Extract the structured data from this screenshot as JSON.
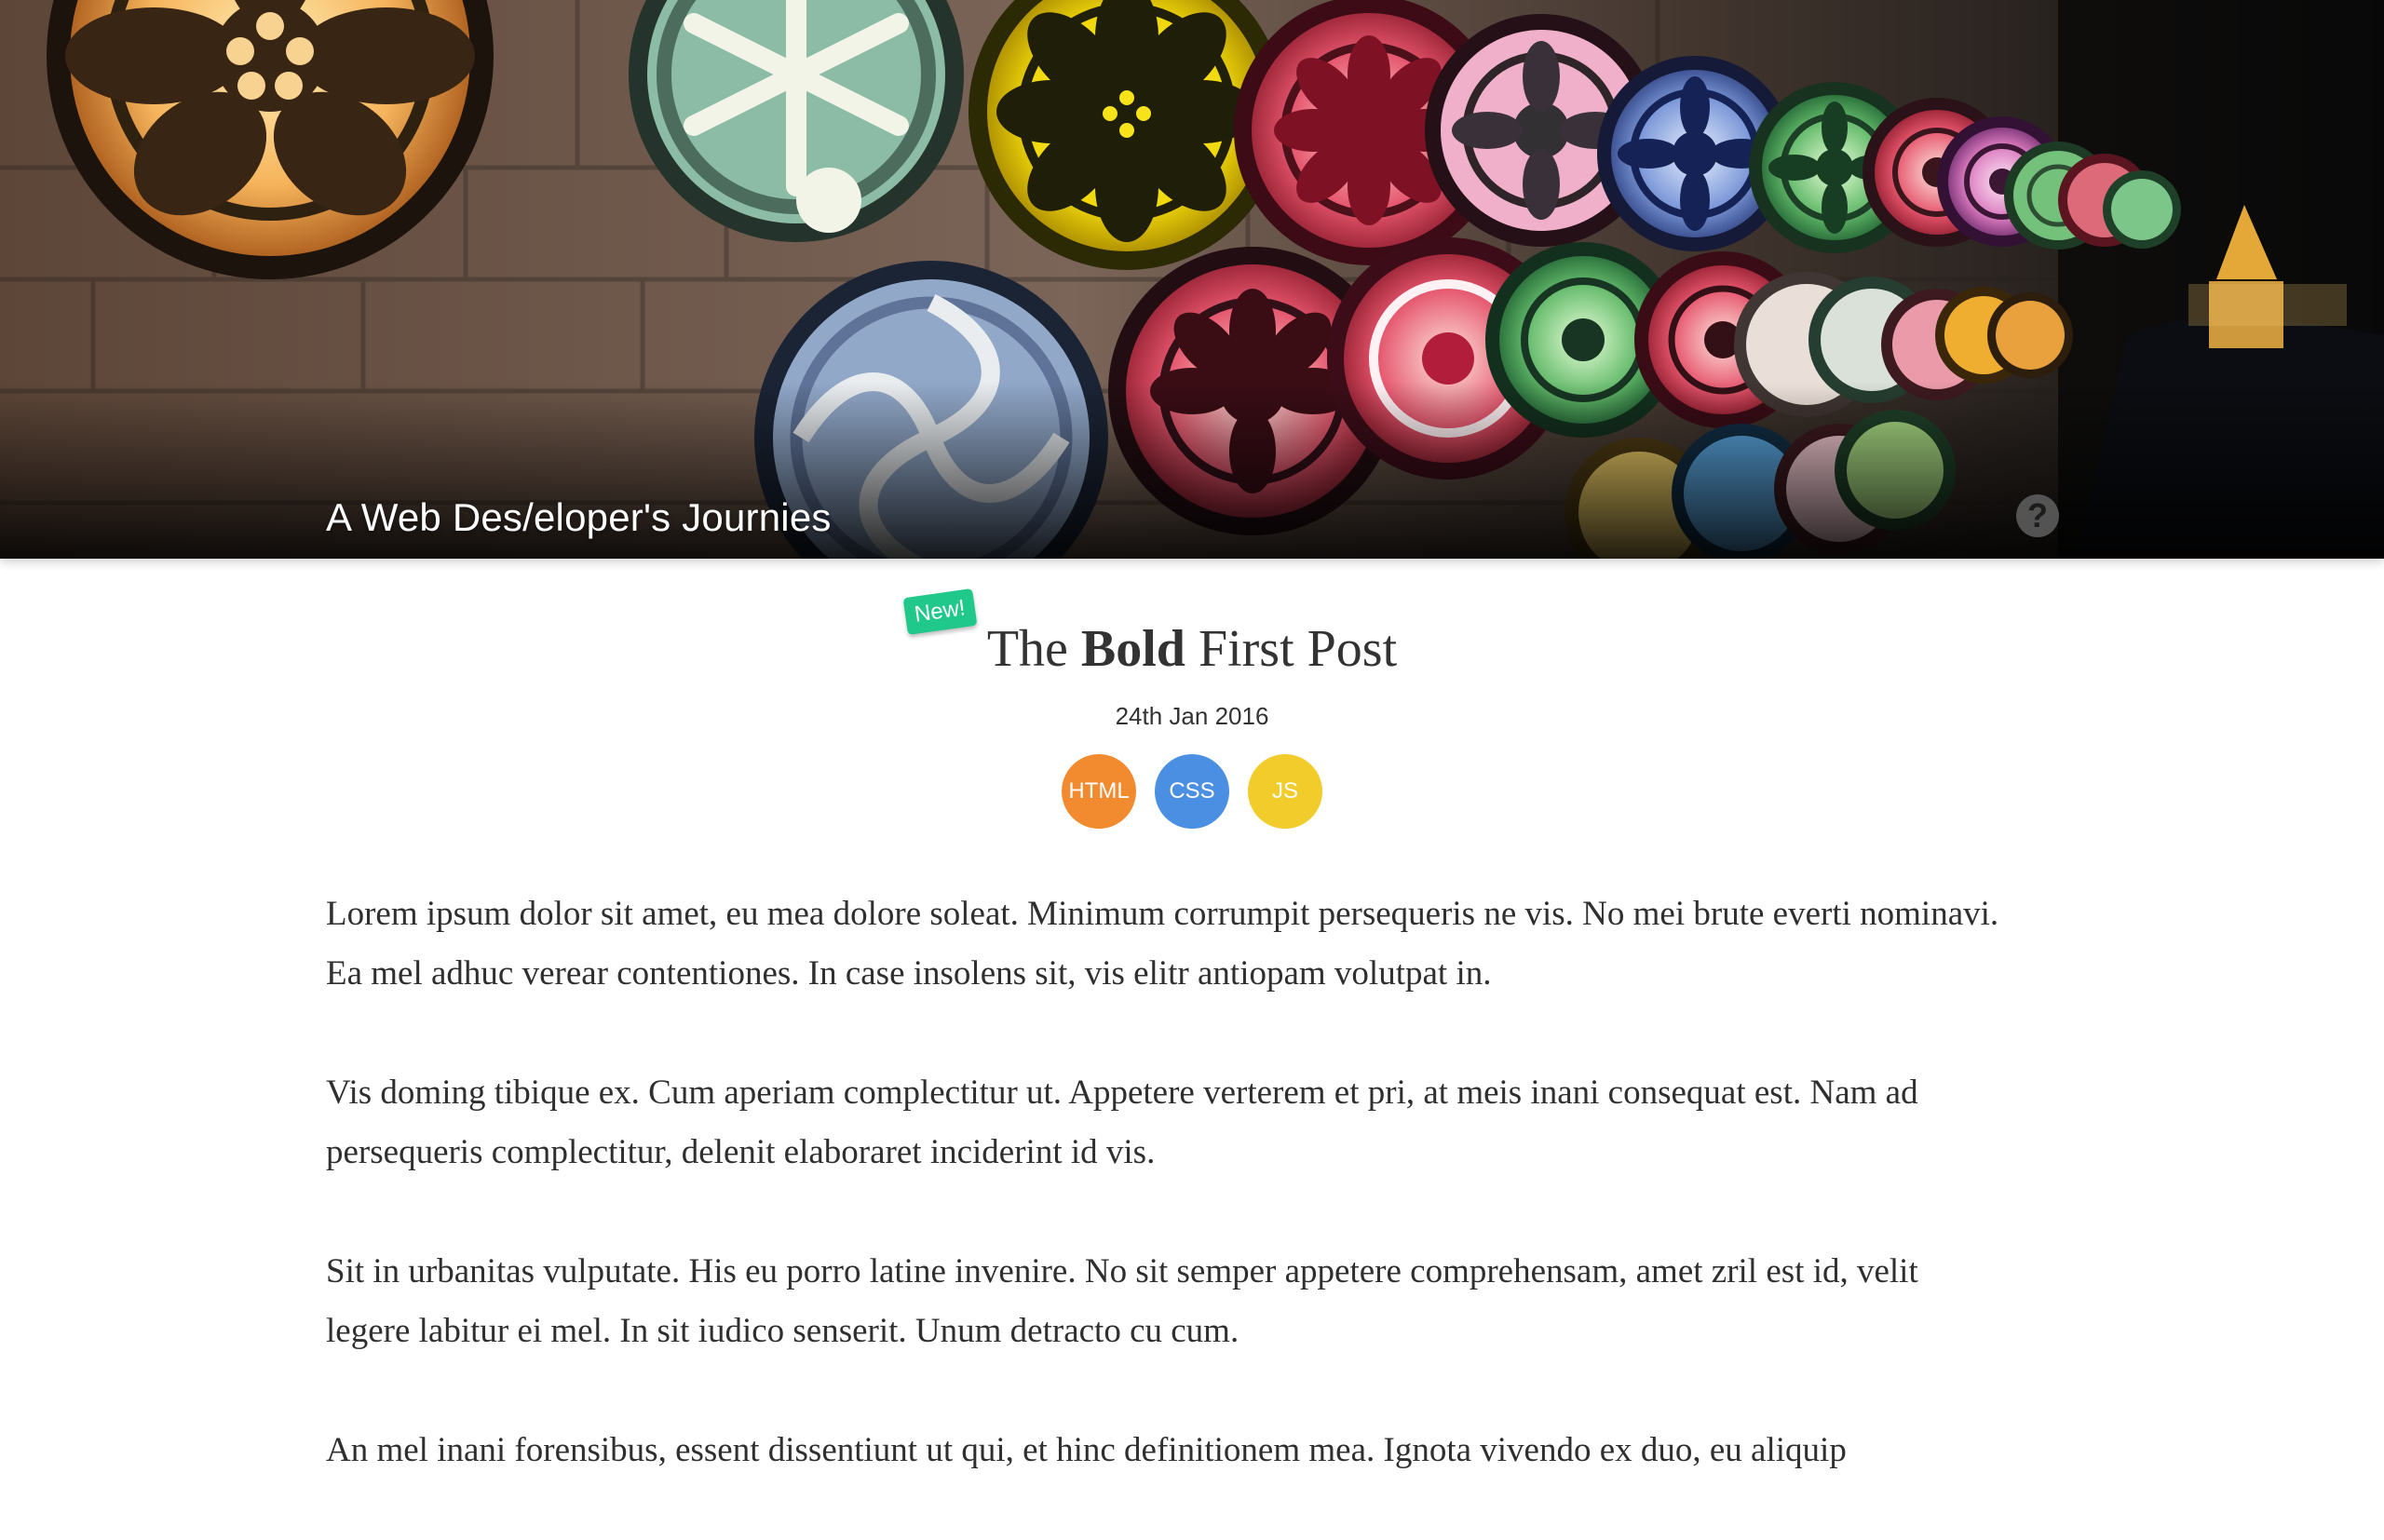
{
  "site": {
    "title": "A Web Des/eloper's Journies",
    "help_label": "?"
  },
  "post": {
    "badge": "New!",
    "title_prefix": "The ",
    "title_bold": "Bold",
    "title_suffix": " First Post",
    "date": "24th Jan 2016",
    "tags": [
      {
        "label": "HTML",
        "color": "#f28a2f"
      },
      {
        "label": "CSS",
        "color": "#4a8fe2"
      },
      {
        "label": "JS",
        "color": "#f2cc2b"
      }
    ],
    "paragraphs": [
      "Lorem ipsum dolor sit amet, eu mea dolore soleat. Minimum corrumpit persequeris ne vis. No mei brute everti nominavi. Ea mel adhuc verear contentiones. In case insolens sit, vis elitr antiopam volutpat in.",
      "Vis doming tibique ex. Cum aperiam complectitur ut. Appetere verterem et pri, at meis inani consequat est. Nam ad persequeris complectitur, delenit elaboraret inciderint id vis.",
      "Sit in urbanitas vulputate. His eu porro latine invenire. No sit semper appetere comprehensam, amet zril est id, velit legere labitur ei mel. In sit iudico senserit. Unum detracto cu cum.",
      "An mel inani forensibus, essent dissentiunt ut qui, et hinc definitionem mea. Ignota vivendo ex duo, eu aliquip"
    ]
  },
  "icons": {
    "help": "question-circle-icon",
    "hero_image": "colorful-lanterns-photo"
  }
}
